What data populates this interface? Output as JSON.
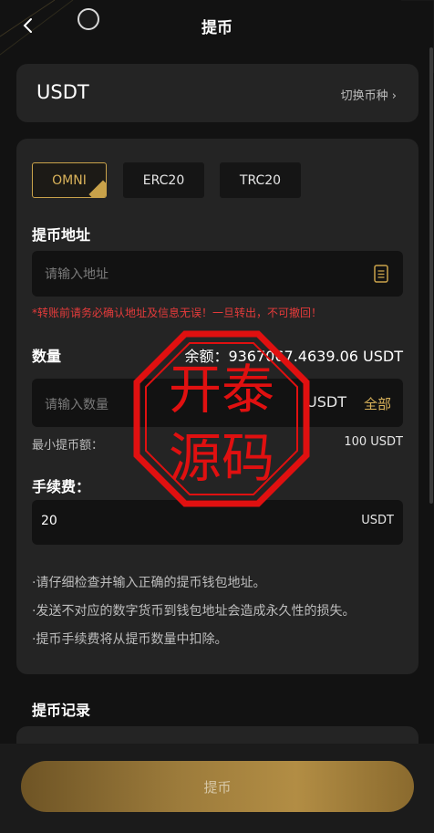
{
  "header": {
    "title": "提币"
  },
  "coin": {
    "name": "USDT",
    "switch_label": "切换币种 ›"
  },
  "networks": [
    "OMNI",
    "ERC20",
    "TRC20"
  ],
  "address": {
    "label": "提币地址",
    "placeholder": "请输入地址",
    "warning": "*转账前请务必确认地址及信息无误！一旦转出，不可撤回！"
  },
  "amount": {
    "label": "数量",
    "balance": "余额：9367067.4639.06 USDT",
    "placeholder": "请输入数量",
    "unit": "USDT",
    "all_label": "全部",
    "min_label": "最小提币额：",
    "min_value": "100 USDT"
  },
  "fee": {
    "label": "手续费：",
    "value": "20",
    "unit": "USDT"
  },
  "tips": [
    "·请仔细检查并输入正确的提币钱包地址。",
    "·发送不对应的数字货币到钱包地址会造成永久性的损失。",
    "·提币手续费将从提币数量中扣除。"
  ],
  "records": {
    "title": "提币记录"
  },
  "submit": {
    "label": "提币"
  },
  "watermark": {
    "line1": "开泰",
    "line2": "源码"
  },
  "colors": {
    "accent": "#c9a24a",
    "warning": "#e53b3b",
    "card": "#242424",
    "background": "#121212"
  }
}
